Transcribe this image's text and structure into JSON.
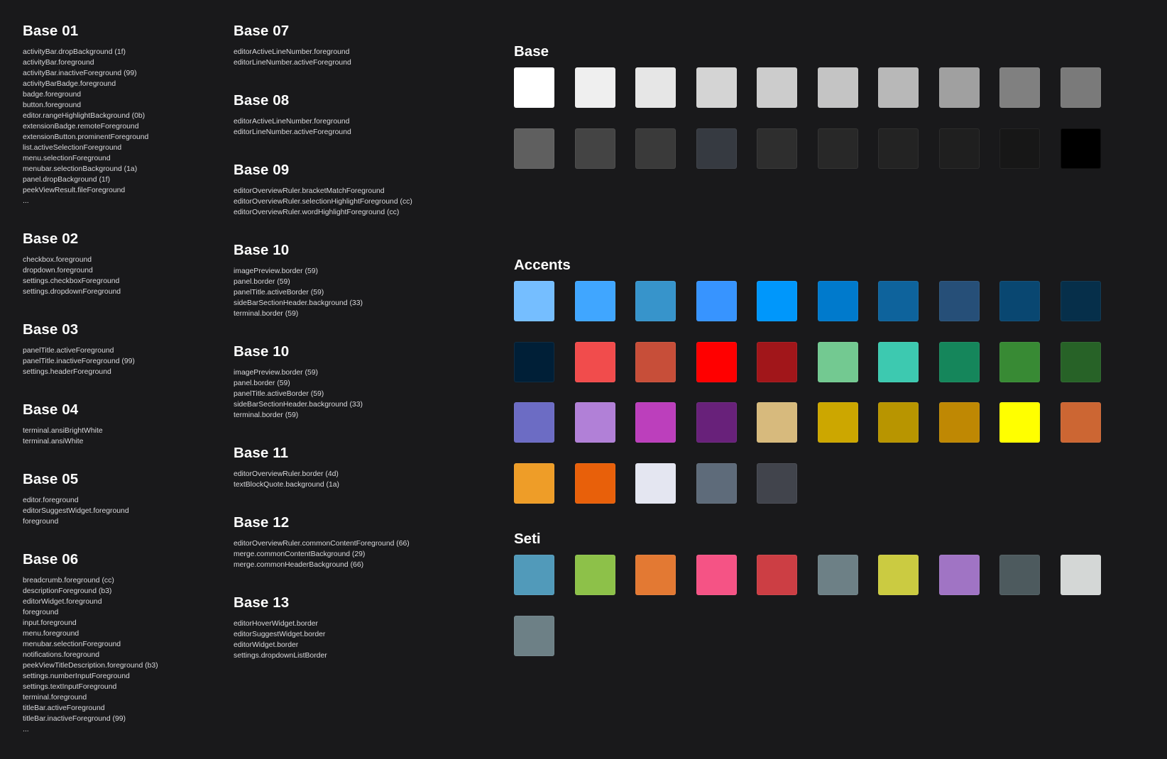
{
  "columns": [
    [
      {
        "title": "Base 01",
        "items": [
          "activityBar.dropBackground (1f)",
          "activityBar.foreground",
          "activityBar.inactiveForeground (99)",
          "activityBarBadge.foreground",
          "badge.foreground",
          "button.foreground",
          "editor.rangeHighlightBackground (0b)",
          "extensionBadge.remoteForeground",
          "extensionButton.prominentForeground",
          "list.activeSelectionForeground",
          "menu.selectionForeground",
          "menubar.selectionBackground (1a)",
          "panel.dropBackground (1f)",
          "peekViewResult.fileForeground",
          "..."
        ]
      },
      {
        "title": "Base 02",
        "items": [
          "checkbox.foreground",
          "dropdown.foreground",
          "settings.checkboxForeground",
          "settings.dropdownForeground"
        ]
      },
      {
        "title": "Base 03",
        "items": [
          "panelTitle.activeForeground",
          "panelTitle.inactiveForeground (99)",
          "settings.headerForeground"
        ]
      },
      {
        "title": "Base 04",
        "items": [
          "terminal.ansiBrightWhite",
          "terminal.ansiWhite"
        ]
      },
      {
        "title": "Base 05",
        "items": [
          "editor.foreground",
          "editorSuggestWidget.foreground",
          "foreground"
        ]
      },
      {
        "title": "Base 06",
        "items": [
          "breadcrumb.foreground (cc)",
          "descriptionForeground (b3)",
          "editorWidget.foreground",
          "foreground",
          "input.foreground",
          "menu.foreground",
          "menubar.selectionForeground",
          "notifications.foreground",
          "peekViewTitleDescription.foreground (b3)",
          "settings.numberInputForeground",
          "settings.textInputForeground",
          "terminal.foreground",
          "titleBar.activeForeground",
          "titleBar.inactiveForeground (99)",
          "..."
        ]
      }
    ],
    [
      {
        "title": "Base 07",
        "items": [
          "editorActiveLineNumber.foreground",
          "editorLineNumber.activeForeground"
        ]
      },
      {
        "title": "Base 08",
        "items": [
          "editorActiveLineNumber.foreground",
          "editorLineNumber.activeForeground"
        ]
      },
      {
        "title": "Base 09",
        "items": [
          "editorOverviewRuler.bracketMatchForeground",
          "editorOverviewRuler.selectionHighlightForeground (cc)",
          "editorOverviewRuler.wordHighlightForeground (cc)"
        ]
      },
      {
        "title": "Base 10",
        "items": [
          "imagePreview.border (59)",
          "panel.border (59)",
          "panelTitle.activeBorder (59)",
          "sideBarSectionHeader.background (33)",
          "terminal.border (59)"
        ]
      },
      {
        "title": "Base 10",
        "items": [
          "imagePreview.border (59)",
          "panel.border (59)",
          "panelTitle.activeBorder (59)",
          "sideBarSectionHeader.background (33)",
          "terminal.border (59)"
        ]
      },
      {
        "title": "Base 11",
        "items": [
          "editorOverviewRuler.border (4d)",
          "textBlockQuote.background (1a)"
        ]
      },
      {
        "title": "Base 12",
        "items": [
          "editorOverviewRuler.commonContentForeground (66)",
          "merge.commonContentBackground (29)",
          "merge.commonHeaderBackground (66)"
        ]
      },
      {
        "title": "Base 13",
        "items": [
          "editorHoverWidget.border",
          "editorSuggestWidget.border",
          "editorWidget.border",
          "settings.dropdownListBorder"
        ]
      }
    ]
  ],
  "palettes": [
    {
      "title": "Base",
      "colors": [
        "#ffffff",
        "#efefef",
        "#e6e6e6",
        "#d4d4d4",
        "#cccccc",
        "#c4c4c4",
        "#b8b8b8",
        "#a0a0a0",
        "#808080",
        "#7a7a7a",
        "#5f5f5f",
        "#444444",
        "#3a3a3a",
        "#363a41",
        "#2e2e2e",
        "#282828",
        "#232323",
        "#1f1f1f",
        "#171717",
        "#000000"
      ]
    },
    {
      "title": "Accents",
      "colors": [
        "#75beff",
        "#40a6ff",
        "#3794cb",
        "#3794ff",
        "#0097fb",
        "#007acc",
        "#0e639c",
        "#264f78",
        "#094771",
        "#062f4a",
        "#001f37",
        "#f14c4c",
        "#c74e39",
        "#ff0000",
        "#a1161a",
        "#73c991",
        "#3dc9b0",
        "#15865b",
        "#388a34",
        "#276227",
        "#6c6cc4",
        "#b180d7",
        "#bc3fbc",
        "#68217a",
        "#d7ba7d",
        "#cca700",
        "#b89500",
        "#bf8803",
        "#ffff00",
        "#cc6633",
        "#ee9d28",
        "#e8600a",
        "#e4e6f1",
        "#5e6b7a",
        "#41444c"
      ]
    },
    {
      "title": "Seti",
      "colors": [
        "#519aba",
        "#8dc149",
        "#e37933",
        "#f55385",
        "#cc3e44",
        "#6d8086",
        "#cbcb41",
        "#a074c4",
        "#4d5a5e",
        "#d4d7d6",
        "#6d8086"
      ]
    }
  ]
}
